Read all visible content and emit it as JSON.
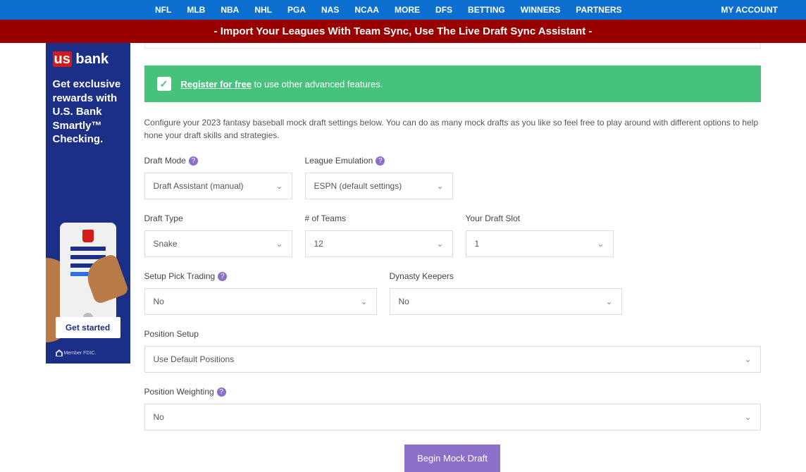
{
  "nav": {
    "items": [
      "NFL",
      "MLB",
      "NBA",
      "NHL",
      "PGA",
      "NAS",
      "NCAA",
      "MORE",
      "DFS",
      "BETTING",
      "WINNERS",
      "PARTNERS"
    ],
    "account": "MY ACCOUNT"
  },
  "redbar": "- Import Your Leagues With Team Sync, Use The Live Draft Sync Assistant -",
  "ad": {
    "logo_html": "us bank",
    "text": "Get exclusive rewards with U.S. Bank Smartly™ Checking.",
    "cta": "Get started",
    "foot": "Member FDIC."
  },
  "banner": {
    "link": "Register for free",
    "rest": " to use other advanced features."
  },
  "desc": "Configure your 2023 fantasy baseball mock draft settings below. You can do as many mock drafts as you like so feel free to play around with different options to help hone your draft skills and strategies.",
  "form": {
    "draft_mode": {
      "label": "Draft Mode",
      "value": "Draft Assistant (manual)"
    },
    "league_emu": {
      "label": "League Emulation",
      "value": "ESPN (default settings)"
    },
    "draft_type": {
      "label": "Draft Type",
      "value": "Snake"
    },
    "num_teams": {
      "label": "# of Teams",
      "value": "12"
    },
    "draft_slot": {
      "label": "Your Draft Slot",
      "value": "1"
    },
    "pick_trading": {
      "label": "Setup Pick Trading",
      "value": "No"
    },
    "dynasty": {
      "label": "Dynasty Keepers",
      "value": "No"
    },
    "position_setup": {
      "label": "Position Setup",
      "value": "Use Default Positions"
    },
    "position_weight": {
      "label": "Position Weighting",
      "value": "No"
    }
  },
  "submit": "Begin Mock Draft"
}
